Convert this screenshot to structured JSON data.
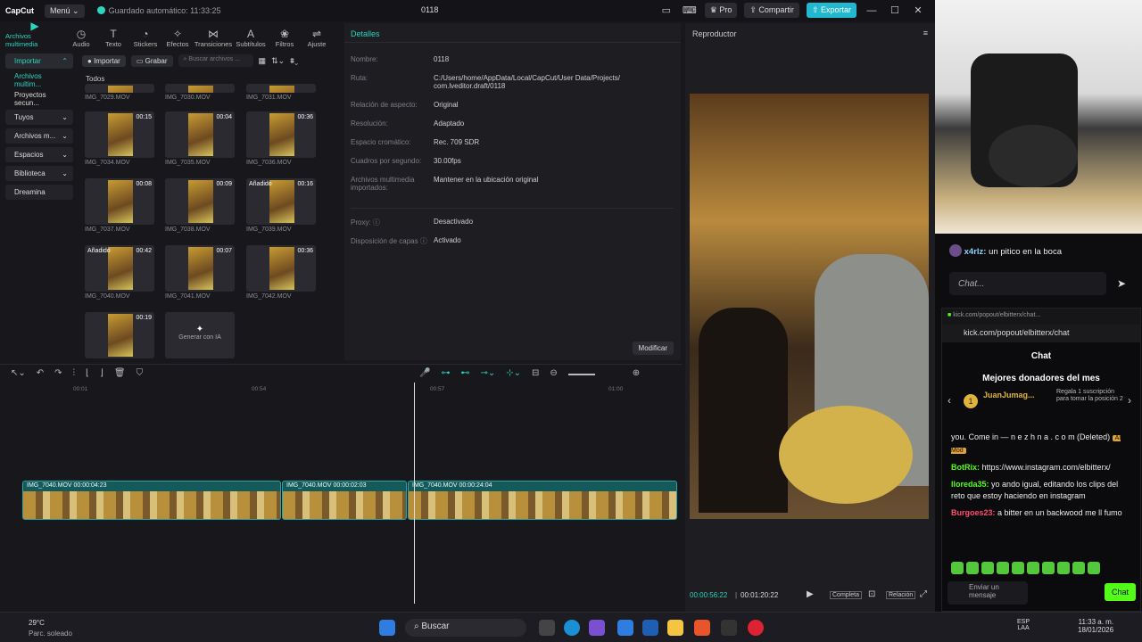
{
  "app": {
    "logo": "CapCut",
    "menu_label": "Menú",
    "autosave": "Guardado automático: 11:33:25",
    "project_title": "0118",
    "pro_label": "Pro",
    "share_label": "Compartir",
    "export_label": "Exportar"
  },
  "toolbar": [
    "Archivos multimedia",
    "Audio",
    "Texto",
    "Stickers",
    "Efectos",
    "Transiciones",
    "Subtítulos",
    "Filtros",
    "Ajuste"
  ],
  "sidebar": {
    "items": [
      "Importar",
      "Archivos multim...",
      "Proyectos secun...",
      "Tuyos",
      "Archivos m...",
      "Espacios",
      "Biblioteca",
      "Dreamina"
    ]
  },
  "media": {
    "import_label": "Importar",
    "record_label": "Grabar",
    "search_placeholder": "Buscar archivos ...",
    "section": "Todos",
    "generate_label": "Generar con IA",
    "items": [
      {
        "name": "IMG_7029.MOV",
        "dur": "",
        "tag": ""
      },
      {
        "name": "IMG_7030.MOV",
        "dur": "",
        "tag": ""
      },
      {
        "name": "IMG_7031.MOV",
        "dur": "",
        "tag": ""
      },
      {
        "name": "IMG_7034.MOV",
        "dur": "00:15",
        "tag": ""
      },
      {
        "name": "IMG_7035.MOV",
        "dur": "00:04",
        "tag": ""
      },
      {
        "name": "IMG_7036.MOV",
        "dur": "00:36",
        "tag": ""
      },
      {
        "name": "IMG_7037.MOV",
        "dur": "00:08",
        "tag": ""
      },
      {
        "name": "IMG_7038.MOV",
        "dur": "00:09",
        "tag": ""
      },
      {
        "name": "IMG_7039.MOV",
        "dur": "00:16",
        "tag": "Añadido"
      },
      {
        "name": "IMG_7040.MOV",
        "dur": "00:42",
        "tag": "Añadido"
      },
      {
        "name": "IMG_7041.MOV",
        "dur": "00:07",
        "tag": ""
      },
      {
        "name": "IMG_7042.MOV",
        "dur": "00:36",
        "tag": ""
      },
      {
        "name": "",
        "dur": "00:19",
        "tag": ""
      }
    ]
  },
  "details": {
    "title": "Detalles",
    "rows": [
      {
        "k": "Nombre:",
        "v": "0118"
      },
      {
        "k": "Ruta:",
        "v": "C:/Users/home/AppData/Local/CapCut/User Data/Projects/ com.lveditor.draft/0118"
      },
      {
        "k": "Relación de aspecto:",
        "v": "Original"
      },
      {
        "k": "Resolución:",
        "v": "Adaptado"
      },
      {
        "k": "Espacio cromático:",
        "v": "Rec. 709 SDR"
      },
      {
        "k": "Cuadros por segundo:",
        "v": "30.00fps"
      },
      {
        "k": "Archivos multimedia importados:",
        "v": "Mantener en la ubicación original"
      },
      {
        "k": "Proxy: ⓘ",
        "v": "Desactivado"
      },
      {
        "k": "Disposición de capas ⓘ",
        "v": "Activado"
      }
    ],
    "modify_label": "Modificar"
  },
  "player": {
    "title": "Reproductor",
    "current": "00:00:56:22",
    "total": "00:01:20:22",
    "complete_label": "Completa",
    "ratio_label": "Relación"
  },
  "timeline": {
    "ruler": [
      "00:01",
      "00:54",
      "00:57",
      "01:00"
    ],
    "clips": [
      {
        "label": "IMG_7040.MOV  00:00:04:23"
      },
      {
        "label": "IMG_7040.MOV  00:00:02:03"
      },
      {
        "label": "IMG_7040.MOV  00:00:24:04"
      }
    ]
  },
  "chat": {
    "top_user": "x4rlz:",
    "top_msg": "un pitico en la boca",
    "placeholder": "Chat...",
    "popout_tab": "kick.com/popout/elbitterx/chat...",
    "url": "kick.com/popout/elbitterx/chat",
    "header": "Chat",
    "donors_title": "Mejores donadores del mes",
    "donor_name": "JuanJumag...",
    "donor_rank": "1",
    "donor_note": "Regala 1 suscripción para tomar la posición 2",
    "messages": [
      {
        "user": "",
        "text": "you. Come in — n e z h n a . c o m (Deleted)",
        "badge": "AI Mod"
      },
      {
        "user": "BotRix:",
        "text": "https://www.instagram.com/elbitterx/"
      },
      {
        "user": "lloreda35:",
        "text": "yo ando igual, editando los clips del reto que estoy haciendo en instagram"
      },
      {
        "user": "Burgoes23:",
        "text": "a bitter en un backwood me ll fumo"
      }
    ],
    "send_label": "Enviar un mensaje",
    "chat_btn": "Chat"
  },
  "taskbar": {
    "temp": "29°C",
    "weather": "Parc. soleado",
    "search": "Buscar",
    "lang1": "ESP",
    "lang2": "LAA",
    "time": "11:33 a. m.",
    "date": "18/01/2026"
  }
}
